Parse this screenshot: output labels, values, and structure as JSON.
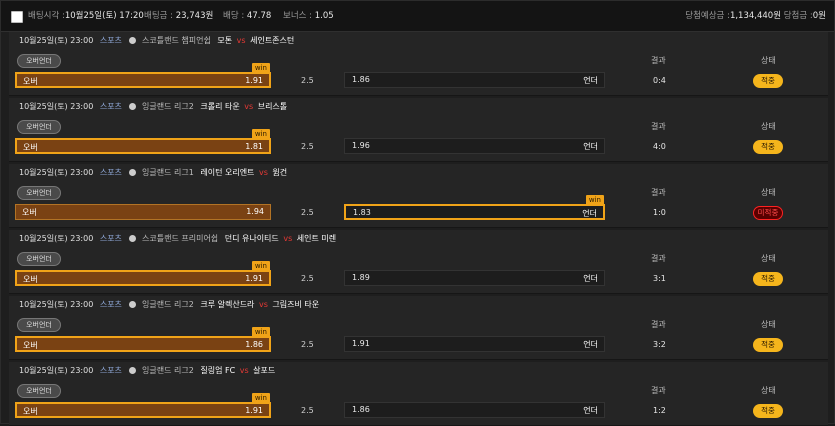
{
  "summary": {
    "bet_time_label": "배팅시각 :",
    "bet_time_value": "10월25일(토) 17:20",
    "amount_label": "배팅금 :",
    "amount_value": "23,743원",
    "odds_label": "배당 :",
    "odds_value": "47.78",
    "bonus_label": "보너스 :",
    "bonus_value": "1.05",
    "expected_label": "당첨예상금 :",
    "expected_value": "1,134,440원",
    "win_label": "당첨금 :",
    "win_value": "0원"
  },
  "bets": [
    {
      "datetime": "10월25일(토) 23:00",
      "sport": "스포츠",
      "league": "스코틀랜드 챔피언쉽",
      "home": "모톤",
      "vs": "vs",
      "away": "세인트존스턴",
      "tag": "오버언더",
      "over_label": "오버",
      "over_odds": "1.91",
      "line": "2.5",
      "under_odds": "1.86",
      "under_label": "언더",
      "win_badge": "win",
      "result_label": "결과",
      "result": "0:4",
      "status_label": "상태",
      "status": "적중"
    },
    {
      "datetime": "10월25일(토) 23:00",
      "sport": "스포츠",
      "league": "잉글랜드 리그2",
      "home": "크롤리 타운",
      "vs": "vs",
      "away": "브리스톨",
      "tag": "오버언더",
      "over_label": "오버",
      "over_odds": "1.81",
      "line": "2.5",
      "under_odds": "1.96",
      "under_label": "언더",
      "win_badge": "win",
      "result_label": "결과",
      "result": "4:0",
      "status_label": "상태",
      "status": "적중"
    },
    {
      "datetime": "10월25일(토) 23:00",
      "sport": "스포츠",
      "league": "잉글랜드 리그1",
      "home": "레이턴 오리엔트",
      "vs": "vs",
      "away": "윔건",
      "tag": "오버언더",
      "over_label": "오버",
      "over_odds": "1.94",
      "line": "2.5",
      "under_odds": "1.83",
      "under_label": "언더",
      "win_badge": "win",
      "result_label": "결과",
      "result": "1:0",
      "status_label": "상태",
      "status": "미적중"
    },
    {
      "datetime": "10월25일(토) 23:00",
      "sport": "스포츠",
      "league": "스코틀랜드 프리미어쉽",
      "home": "던디 유나이티드",
      "vs": "vs",
      "away": "세인트 미렌",
      "tag": "오버언더",
      "over_label": "오버",
      "over_odds": "1.91",
      "line": "2.5",
      "under_odds": "1.89",
      "under_label": "언더",
      "win_badge": "win",
      "result_label": "결과",
      "result": "3:1",
      "status_label": "상태",
      "status": "적중"
    },
    {
      "datetime": "10월25일(토) 23:00",
      "sport": "스포츠",
      "league": "잉글랜드 리그2",
      "home": "크루 알렉산드라",
      "vs": "vs",
      "away": "그림즈비 타운",
      "tag": "오버언더",
      "over_label": "오버",
      "over_odds": "1.86",
      "line": "2.5",
      "under_odds": "1.91",
      "under_label": "언더",
      "win_badge": "win",
      "result_label": "결과",
      "result": "3:2",
      "status_label": "상태",
      "status": "적중"
    },
    {
      "datetime": "10월25일(토) 23:00",
      "sport": "스포츠",
      "league": "잉글랜드 리그2",
      "home": "질링엄 FC",
      "vs": "vs",
      "away": "살포드",
      "tag": "오버언더",
      "over_label": "오버",
      "over_odds": "1.91",
      "line": "2.5",
      "under_odds": "1.86",
      "under_label": "언더",
      "win_badge": "win",
      "result_label": "결과",
      "result": "1:2",
      "status_label": "상태",
      "status": "적중"
    }
  ]
}
